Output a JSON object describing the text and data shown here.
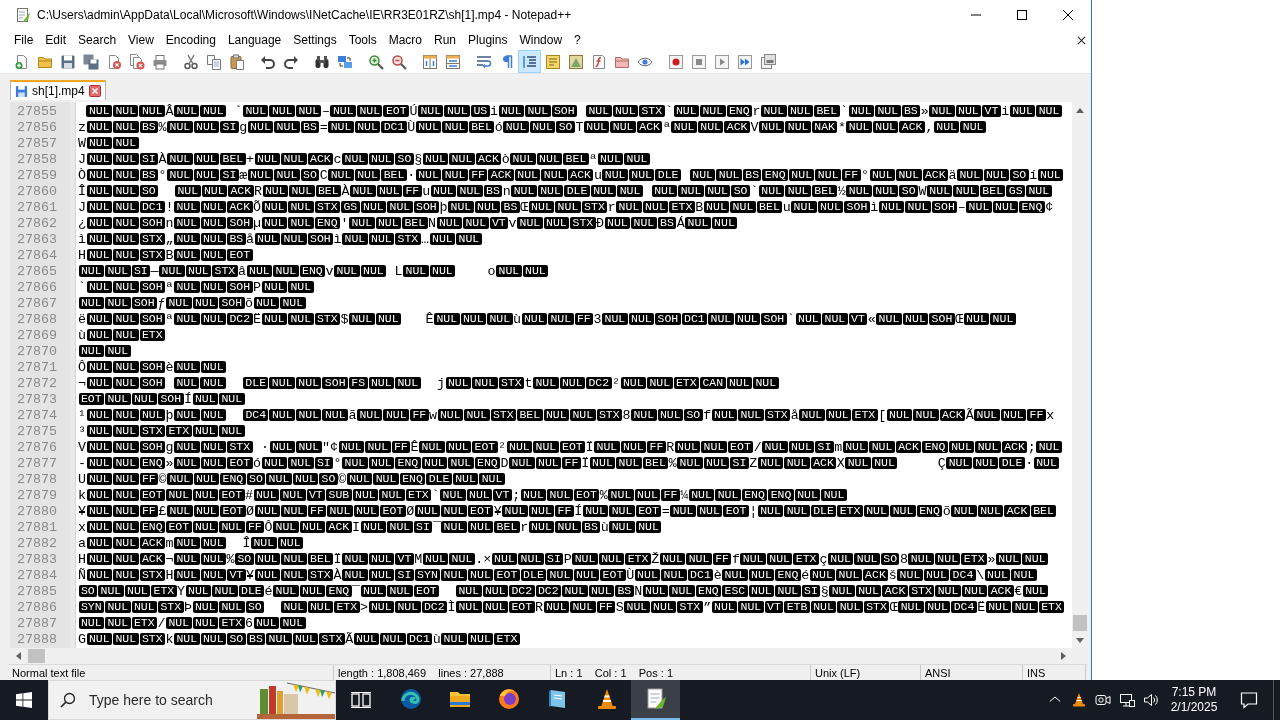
{
  "window": {
    "title": "C:\\Users\\admin\\AppData\\Local\\Microsoft\\Windows\\INetCache\\IE\\RR3E01RZ\\sh[1].mp4 - Notepad++"
  },
  "menu": [
    "File",
    "Edit",
    "Search",
    "View",
    "Encoding",
    "Language",
    "Settings",
    "Tools",
    "Macro",
    "Run",
    "Plugins",
    "Window",
    "?"
  ],
  "toolbar": [
    {
      "on": false
    },
    {
      "on": false
    },
    {
      "on": false
    },
    {
      "on": false
    },
    {
      "on": false
    },
    {
      "on": false
    },
    {
      "on": false
    },
    {
      "on": false
    },
    {
      "on": false
    },
    {
      "on": false
    },
    {
      "on": false
    },
    {
      "on": false
    },
    {
      "on": false
    },
    {
      "on": false
    },
    {
      "on": false
    },
    {
      "on": false
    },
    {
      "on": false
    },
    {
      "on": false
    },
    {
      "on": false
    },
    {
      "on": false
    },
    {
      "on": true
    },
    {
      "on": false
    },
    {
      "on": false
    },
    {
      "on": false
    },
    {
      "on": false
    },
    {
      "on": false
    },
    {
      "on": false
    },
    {
      "on": false
    },
    {
      "on": false
    },
    {
      "on": false
    },
    {
      "on": false
    }
  ],
  "tabs": [
    {
      "label": "sh[1].mp4",
      "selected": true
    }
  ],
  "editor": {
    "lines": [
      {
        "number": "27855",
        "indent": true,
        "groups": [
          {
            "codes": [
              "NUL",
              "NUL",
              "NUL"
            ],
            "after": "Â"
          },
          {
            "codes": [
              "NUL",
              "NUL"
            ],
            "after": " `"
          },
          {
            "codes": [
              "NUL",
              "NUL",
              "NUL"
            ],
            "after": "–"
          },
          {
            "codes": [
              "NUL",
              "NUL",
              "EOT"
            ],
            "after": "Ú"
          },
          {
            "codes": [
              "NUL",
              "NUL",
              "US"
            ],
            "after": "i"
          },
          {
            "codes": [
              "NUL",
              "NUL",
              "SOH"
            ],
            "gap": true
          },
          {
            "codes": [
              "NUL",
              "NUL",
              "STX"
            ],
            "after": "`"
          },
          {
            "codes": [
              "NUL",
              "NUL",
              "ENQ"
            ],
            "after": "r"
          },
          {
            "codes": [
              "NUL",
              "NUL",
              "BEL"
            ],
            "after": "`"
          },
          {
            "codes": [
              "NUL",
              "NUL",
              "BS"
            ],
            "after": "»"
          },
          {
            "codes": [
              "NUL",
              "NUL",
              "VT"
            ],
            "after": "i"
          },
          {
            "codes": [
              "NUL",
              "NUL"
            ]
          }
        ]
      },
      {
        "number": "27856",
        "lead": "z",
        "groups": [
          {
            "codes": [
              "NUL",
              "NUL",
              "BS"
            ],
            "after": "%"
          },
          {
            "codes": [
              "NUL",
              "NUL",
              "SI"
            ],
            "after": "g"
          },
          {
            "codes": [
              "NUL",
              "NUL",
              "BS"
            ],
            "after": "="
          },
          {
            "codes": [
              "NUL",
              "NUL",
              "DC1"
            ],
            "after": "Ù"
          },
          {
            "codes": [
              "NUL",
              "NUL",
              "BEL"
            ],
            "after": "ó"
          },
          {
            "codes": [
              "NUL",
              "NUL",
              "SO"
            ],
            "after": "T"
          },
          {
            "codes": [
              "NUL",
              "NUL",
              "ACK"
            ],
            "after": "ª"
          },
          {
            "codes": [
              "NUL",
              "NUL",
              "ACK"
            ],
            "after": "V"
          },
          {
            "codes": [
              "NUL",
              "NUL",
              "NAK"
            ],
            "after": "*"
          },
          {
            "codes": [
              "NUL",
              "NUL",
              "ACK"
            ],
            "after": ","
          },
          {
            "codes": [
              "NUL",
              "NUL"
            ]
          }
        ]
      },
      {
        "number": "27857",
        "lead": "W",
        "groups": [
          {
            "codes": [
              "NUL",
              "NUL"
            ]
          }
        ]
      },
      {
        "number": "27858",
        "lead": "J",
        "groups": [
          {
            "codes": [
              "NUL",
              "NUL",
              "SI"
            ],
            "after": "À"
          },
          {
            "codes": [
              "NUL",
              "NUL",
              "BEL"
            ],
            "after": "+"
          },
          {
            "codes": [
              "NUL",
              "NUL",
              "ACK"
            ],
            "after": "c"
          },
          {
            "codes": [
              "NUL",
              "NUL",
              "SO"
            ],
            "after": "§"
          },
          {
            "codes": [
              "NUL",
              "NUL",
              "ACK"
            ],
            "after": "ò"
          },
          {
            "codes": [
              "NUL",
              "NUL",
              "BEL"
            ],
            "after": "ª"
          },
          {
            "codes": [
              "NUL",
              "NUL"
            ]
          }
        ]
      },
      {
        "number": "27859",
        "lead": "Ò",
        "groups": [
          {
            "codes": [
              "NUL",
              "NUL",
              "BS"
            ],
            "after": "°"
          },
          {
            "codes": [
              "NUL",
              "NUL",
              "SI"
            ],
            "after": "æ"
          },
          {
            "codes": [
              "NUL",
              "NUL",
              "SO"
            ],
            "after": "C"
          },
          {
            "codes": [
              "NUL",
              "NUL",
              "BEL"
            ],
            "after": "·"
          },
          {
            "codes": [
              "NUL",
              "NUL",
              "FF",
              "ACK",
              "NUL",
              "NUL",
              "ACK"
            ],
            "after": "u"
          },
          {
            "codes": [
              "NUL",
              "NUL",
              "DLE"
            ],
            "gap": true
          },
          {
            "codes": [
              "NUL",
              "NUL",
              "BS",
              "ENQ",
              "NUL",
              "NUL",
              "FF"
            ],
            "after": "°"
          },
          {
            "codes": [
              "NUL",
              "NUL",
              "ACK"
            ],
            "after": "ä"
          },
          {
            "codes": [
              "NUL",
              "NUL",
              "SO"
            ],
            "after": "í"
          },
          {
            "codes": [
              "NUL"
            ]
          }
        ]
      },
      {
        "number": "27860",
        "lead": "Î",
        "groups": [
          {
            "codes": [
              "NUL",
              "NUL",
              "SO"
            ],
            "wide_gap": true
          },
          {
            "codes": [
              "NUL",
              "NUL",
              "ACK"
            ],
            "after": "R"
          },
          {
            "codes": [
              "NUL",
              "NUL",
              "BEL"
            ],
            "after": "À"
          },
          {
            "codes": [
              "NUL",
              "NUL",
              "FF"
            ],
            "after": "u"
          },
          {
            "codes": [
              "NUL",
              "NUL",
              "BS"
            ],
            "after": "n"
          },
          {
            "codes": [
              "NUL",
              "NUL",
              "DLE",
              "NUL",
              "NUL"
            ],
            "gap": true
          },
          {
            "codes": [
              "NUL",
              "NUL",
              "NUL",
              "SO"
            ],
            "after": "`"
          },
          {
            "codes": [
              "NUL",
              "NUL",
              "BEL"
            ],
            "after": "½"
          },
          {
            "codes": [
              "NUL",
              "NUL",
              "SO"
            ],
            "after": "W"
          },
          {
            "codes": [
              "NUL",
              "NUL",
              "BEL",
              "GS",
              "NUL"
            ]
          }
        ]
      },
      {
        "number": "27861",
        "lead": "J",
        "groups": [
          {
            "codes": [
              "NUL",
              "NUL",
              "DC1"
            ],
            "after": "!"
          },
          {
            "codes": [
              "NUL",
              "NUL",
              "ACK"
            ],
            "after": "Õ"
          },
          {
            "codes": [
              "NUL",
              "NUL",
              "STX",
              "GS",
              "NUL",
              "NUL",
              "SOH"
            ],
            "after": "þ"
          },
          {
            "codes": [
              "NUL",
              "NUL",
              "BS"
            ],
            "after": "Œ"
          },
          {
            "codes": [
              "NUL",
              "NUL",
              "STX"
            ],
            "after": "r"
          },
          {
            "codes": [
              "NUL",
              "NUL",
              "ETX"
            ],
            "after": "B"
          },
          {
            "codes": [
              "NUL",
              "NUL",
              "BEL"
            ],
            "after": "u"
          },
          {
            "codes": [
              "NUL",
              "NUL",
              "SOH"
            ],
            "after": "ì"
          },
          {
            "codes": [
              "NUL",
              "NUL",
              "SOH"
            ],
            "after": "–"
          },
          {
            "codes": [
              "NUL",
              "NUL",
              "ENQ"
            ],
            "after": "¢"
          }
        ]
      },
      {
        "number": "27862",
        "lead": "¿",
        "groups": [
          {
            "codes": [
              "NUL",
              "NUL",
              "SOH"
            ],
            "after": "n"
          },
          {
            "codes": [
              "NUL",
              "NUL",
              "SOH"
            ],
            "after": "µ"
          },
          {
            "codes": [
              "NUL",
              "NUL",
              "ENQ"
            ],
            "after": "'"
          },
          {
            "codes": [
              "NUL",
              "NUL",
              "BEL"
            ],
            "after": "N"
          },
          {
            "codes": [
              "NUL",
              "NUL",
              "VT"
            ],
            "after": "v"
          },
          {
            "codes": [
              "NUL",
              "NUL",
              "STX"
            ],
            "after": "Ð"
          },
          {
            "codes": [
              "NUL",
              "NUL",
              "BS"
            ],
            "after": "Á"
          },
          {
            "codes": [
              "NUL",
              "NUL"
            ]
          }
        ]
      },
      {
        "number": "27863",
        "lead": "ì",
        "groups": [
          {
            "codes": [
              "NUL",
              "NUL",
              "STX"
            ],
            "after": "„"
          },
          {
            "codes": [
              "NUL",
              "NUL",
              "BS"
            ],
            "after": "å"
          },
          {
            "codes": [
              "NUL",
              "NUL",
              "SOH"
            ],
            "after": "ì"
          },
          {
            "codes": [
              "NUL",
              "NUL",
              "STX"
            ],
            "after": "…"
          },
          {
            "codes": [
              "NUL",
              "NUL"
            ]
          }
        ]
      },
      {
        "number": "27864",
        "lead": "H",
        "groups": [
          {
            "codes": [
              "NUL",
              "NUL",
              "STX"
            ],
            "after": "B"
          },
          {
            "codes": [
              "NUL",
              "NUL",
              "EOT"
            ]
          }
        ]
      },
      {
        "number": "27865",
        "groups": [
          {
            "codes": [
              "NUL",
              "NUL",
              "SI"
            ],
            "after": "—"
          },
          {
            "codes": [
              "NUL",
              "NUL",
              "STX"
            ],
            "after": "â"
          },
          {
            "codes": [
              "NUL",
              "NUL",
              "ENQ"
            ],
            "after": "v"
          },
          {
            "codes": [
              "NUL",
              "NUL"
            ],
            "after": " L"
          },
          {
            "codes": [
              "NUL",
              "NUL"
            ],
            "after": "    o"
          },
          {
            "codes": [
              "NUL",
              "NUL"
            ]
          }
        ]
      },
      {
        "number": "27866",
        "lead": "`",
        "groups": [
          {
            "codes": [
              "NUL",
              "NUL",
              "SOH"
            ],
            "after": "ª"
          },
          {
            "codes": [
              "NUL",
              "NUL",
              "SOH"
            ],
            "after": "P"
          },
          {
            "codes": [
              "NUL",
              "NUL"
            ]
          }
        ]
      },
      {
        "number": "27867",
        "groups": [
          {
            "codes": [
              "NUL",
              "NUL",
              "SOH"
            ],
            "after": "ƒ"
          },
          {
            "codes": [
              "NUL",
              "NUL",
              "SOH"
            ],
            "after": "õ"
          },
          {
            "codes": [
              "NUL",
              "NUL"
            ]
          }
        ]
      },
      {
        "number": "27868",
        "lead": "ë",
        "groups": [
          {
            "codes": [
              "NUL",
              "NUL",
              "SOH"
            ],
            "after": "ª"
          },
          {
            "codes": [
              "NUL",
              "NUL",
              "DC2"
            ],
            "after": "Ë"
          },
          {
            "codes": [
              "NUL",
              "NUL",
              "STX"
            ],
            "after": "$"
          },
          {
            "codes": [
              "NUL",
              "NUL"
            ],
            "after": "   Ê"
          },
          {
            "codes": [
              "NUL",
              "NUL",
              "NUL"
            ],
            "after": "ù"
          },
          {
            "codes": [
              "NUL",
              "NUL",
              "FF"
            ],
            "after": "3"
          },
          {
            "codes": [
              "NUL",
              "NUL",
              "SOH",
              "DC1",
              "NUL",
              "NUL",
              "SOH"
            ],
            "after": "`"
          },
          {
            "codes": [
              "NUL",
              "NUL",
              "VT"
            ],
            "after": "«"
          },
          {
            "codes": [
              "NUL",
              "NUL",
              "SOH"
            ],
            "after": "Œ"
          },
          {
            "codes": [
              "NUL",
              "NUL"
            ]
          }
        ]
      },
      {
        "number": "27869",
        "lead": "ù",
        "groups": [
          {
            "codes": [
              "NUL",
              "NUL",
              "ETX"
            ]
          }
        ]
      },
      {
        "number": "27870",
        "groups": [
          {
            "codes": [
              "NUL",
              "NUL"
            ]
          }
        ]
      },
      {
        "number": "27871",
        "lead": "Ô",
        "groups": [
          {
            "codes": [
              "NUL",
              "NUL",
              "SOH"
            ],
            "after": "è"
          },
          {
            "codes": [
              "NUL",
              "NUL"
            ]
          }
        ]
      },
      {
        "number": "27872",
        "lead": "¬",
        "groups": [
          {
            "codes": [
              "NUL",
              "NUL",
              "SOH"
            ],
            "gap": true
          },
          {
            "codes": [
              "NUL",
              "NUL"
            ],
            "wide_gap": true
          },
          {
            "codes": [
              "DLE",
              "NUL",
              "NUL",
              "SOH",
              "FS",
              "NUL",
              "NUL"
            ],
            "after": "  j"
          },
          {
            "codes": [
              "NUL",
              "NUL",
              "STX"
            ],
            "after": "t"
          },
          {
            "codes": [
              "NUL",
              "NUL",
              "DC2"
            ],
            "after": "²"
          },
          {
            "codes": [
              "NUL",
              "NUL",
              "ETX",
              "CAN",
              "NUL",
              "NUL"
            ]
          }
        ]
      },
      {
        "number": "27873",
        "groups": [
          {
            "codes": [
              "EOT",
              "NUL",
              "NUL",
              "SOH"
            ],
            "after": "Í"
          },
          {
            "codes": [
              "NUL",
              "NUL"
            ]
          }
        ]
      },
      {
        "number": "27874",
        "lead": "¹",
        "groups": [
          {
            "codes": [
              "NUL",
              "NUL",
              "NUL"
            ],
            "after": "þ"
          },
          {
            "codes": [
              "NUL",
              "NUL"
            ],
            "wide_gap": true
          },
          {
            "codes": [
              "DC4",
              "NUL",
              "NUL",
              "NUL"
            ],
            "after": "ã"
          },
          {
            "codes": [
              "NUL",
              "NUL",
              "FF"
            ],
            "after": "w"
          },
          {
            "codes": [
              "NUL",
              "NUL",
              "STX",
              "BEL",
              "NUL",
              "NUL",
              "STX"
            ],
            "after": "8"
          },
          {
            "codes": [
              "NUL",
              "NUL",
              "SO"
            ],
            "after": "f"
          },
          {
            "codes": [
              "NUL",
              "NUL",
              "STX"
            ],
            "after": "å"
          },
          {
            "codes": [
              "NUL",
              "NUL",
              "ETX"
            ],
            "after": "["
          },
          {
            "codes": [
              "NUL",
              "NUL",
              "ACK"
            ],
            "after": "Ã"
          },
          {
            "codes": [
              "NUL",
              "NUL",
              "FF"
            ],
            "after": "x"
          }
        ]
      },
      {
        "number": "27875",
        "lead": "³",
        "groups": [
          {
            "codes": [
              "NUL",
              "NUL",
              "STX",
              "ETX",
              "NUL",
              "NUL"
            ]
          }
        ]
      },
      {
        "number": "27876",
        "lead": "V",
        "groups": [
          {
            "codes": [
              "NUL",
              "NUL",
              "SOH"
            ],
            "after": "g"
          },
          {
            "codes": [
              "NUL",
              "NUL",
              "STX"
            ],
            "after": " ·"
          },
          {
            "codes": [
              "NUL",
              "NUL"
            ],
            "after": "\"¢"
          },
          {
            "codes": [
              "NUL",
              "NUL",
              "FF"
            ],
            "after": "Ê"
          },
          {
            "codes": [
              "NUL",
              "NUL",
              "EOT"
            ],
            "after": "²"
          },
          {
            "codes": [
              "NUL",
              "NUL",
              "EOT"
            ],
            "after": "Ï"
          },
          {
            "codes": [
              "NUL",
              "NUL",
              "FF"
            ],
            "after": "R"
          },
          {
            "codes": [
              "NUL",
              "NUL",
              "EOT"
            ],
            "after": "/"
          },
          {
            "codes": [
              "NUL",
              "NUL",
              "SI"
            ],
            "after": "m"
          },
          {
            "codes": [
              "NUL",
              "NUL",
              "ACK",
              "ENQ",
              "NUL",
              "NUL",
              "ACK"
            ],
            "after": ";"
          },
          {
            "codes": [
              "NUL"
            ]
          }
        ]
      },
      {
        "number": "27877",
        "lead": "-",
        "groups": [
          {
            "codes": [
              "NUL",
              "NUL",
              "ENQ"
            ],
            "after": "»"
          },
          {
            "codes": [
              "NUL",
              "NUL",
              "EOT"
            ],
            "after": "ó"
          },
          {
            "codes": [
              "NUL",
              "NUL",
              "SI"
            ],
            "after": "°"
          },
          {
            "codes": [
              "NUL",
              "NUL",
              "ENQ",
              "NUL",
              "NUL",
              "ENQ"
            ],
            "after": "D"
          },
          {
            "codes": [
              "NUL",
              "NUL",
              "FF"
            ],
            "after": "Ï"
          },
          {
            "codes": [
              "NUL",
              "NUL",
              "BEL"
            ],
            "after": "%"
          },
          {
            "codes": [
              "NUL",
              "NUL",
              "SI"
            ],
            "after": "Z"
          },
          {
            "codes": [
              "NUL",
              "NUL",
              "ACK"
            ],
            "after": "X"
          },
          {
            "codes": [
              "NUL",
              "NUL"
            ],
            "after": "     Ç"
          },
          {
            "codes": [
              "NUL",
              "NUL",
              "DLE"
            ],
            "after": "·"
          },
          {
            "codes": [
              "NUL"
            ]
          }
        ]
      },
      {
        "number": "27878",
        "lead": "U",
        "groups": [
          {
            "codes": [
              "NUL",
              "NUL",
              "FF"
            ],
            "after": "©"
          },
          {
            "codes": [
              "NUL",
              "NUL",
              "ENQ",
              "SO",
              "NUL",
              "NUL",
              "SO"
            ],
            "after": "©"
          },
          {
            "codes": [
              "NUL",
              "NUL",
              "ENQ",
              "DLE",
              "NUL",
              "NUL"
            ]
          }
        ]
      },
      {
        "number": "27879",
        "lead": "k",
        "groups": [
          {
            "codes": [
              "NUL",
              "NUL",
              "EOT",
              "NUL",
              "NUL",
              "EOT"
            ],
            "after": "#"
          },
          {
            "codes": [
              "NUL",
              "NUL",
              "VT",
              "SUB",
              "NUL",
              "NUL",
              "ETX"
            ],
            "after": "`"
          },
          {
            "codes": [
              "NUL",
              "NUL",
              "VT"
            ],
            "after": ";"
          },
          {
            "codes": [
              "NUL",
              "NUL",
              "EOT"
            ],
            "after": "%"
          },
          {
            "codes": [
              "NUL",
              "NUL",
              "FF"
            ],
            "after": "¼"
          },
          {
            "codes": [
              "NUL",
              "NUL",
              "ENQ",
              "ENQ",
              "NUL",
              "NUL"
            ]
          }
        ]
      },
      {
        "number": "27880",
        "lead": "¥",
        "groups": [
          {
            "codes": [
              "NUL",
              "NUL",
              "FF"
            ],
            "after": "£"
          },
          {
            "codes": [
              "NUL",
              "NUL",
              "EOT"
            ],
            "after": "Ø"
          },
          {
            "codes": [
              "NUL",
              "NUL",
              "FF",
              "NUL",
              "NUL",
              "EOT"
            ],
            "after": "Ø"
          },
          {
            "codes": [
              "NUL",
              "NUL",
              "EOT"
            ],
            "after": "¥"
          },
          {
            "codes": [
              "NUL",
              "NUL",
              "FF"
            ],
            "after": "Í"
          },
          {
            "codes": [
              "NUL",
              "NUL",
              "EOT"
            ],
            "after": "="
          },
          {
            "codes": [
              "NUL",
              "NUL",
              "EOT"
            ],
            "after": "¦"
          },
          {
            "codes": [
              "NUL",
              "NUL",
              "DLE",
              "ETX",
              "NUL",
              "NUL",
              "ENQ"
            ],
            "after": "õ"
          },
          {
            "codes": [
              "NUL",
              "NUL",
              "ACK",
              "BEL"
            ]
          }
        ]
      },
      {
        "number": "27881",
        "lead": "x",
        "groups": [
          {
            "codes": [
              "NUL",
              "NUL",
              "ENQ",
              "EOT",
              "NUL",
              "NUL",
              "FF"
            ],
            "after": "Ô"
          },
          {
            "codes": [
              "NUL",
              "NUL",
              "ACK"
            ],
            "after": "I"
          },
          {
            "codes": [
              "NUL",
              "NUL",
              "SI"
            ],
            "after": "¯"
          },
          {
            "codes": [
              "NUL",
              "NUL",
              "BEL"
            ],
            "after": "r"
          },
          {
            "codes": [
              "NUL",
              "NUL",
              "BS"
            ],
            "after": "ù"
          },
          {
            "codes": [
              "NUL",
              "NUL"
            ]
          }
        ]
      },
      {
        "number": "27882",
        "lead": "a",
        "groups": [
          {
            "codes": [
              "NUL",
              "NUL",
              "ACK"
            ],
            "after": "m"
          },
          {
            "codes": [
              "NUL",
              "NUL"
            ],
            "after": "  Î"
          },
          {
            "codes": [
              "NUL",
              "NUL"
            ]
          }
        ]
      },
      {
        "number": "27883",
        "lead": "H",
        "groups": [
          {
            "codes": [
              "NUL",
              "NUL",
              "ACK"
            ],
            "after": "¬"
          },
          {
            "codes": [
              "NUL",
              "NUL"
            ],
            "after": "%"
          },
          {
            "codes": [
              "SO",
              "NUL",
              "NUL",
              "BEL"
            ],
            "after": "Ï"
          },
          {
            "codes": [
              "NUL",
              "NUL",
              "VT"
            ],
            "after": "M"
          },
          {
            "codes": [
              "NUL",
              "NUL"
            ],
            "after": ".×"
          },
          {
            "codes": [
              "NUL",
              "NUL",
              "SI"
            ],
            "after": "P"
          },
          {
            "codes": [
              "NUL",
              "NUL",
              "ETX"
            ],
            "after": "Ž"
          },
          {
            "codes": [
              "NUL",
              "NUL",
              "FF"
            ],
            "after": "f"
          },
          {
            "codes": [
              "NUL",
              "NUL",
              "ETX"
            ],
            "after": "ç"
          },
          {
            "codes": [
              "NUL",
              "NUL",
              "SO"
            ],
            "after": "8"
          },
          {
            "codes": [
              "NUL",
              "NUL",
              "ETX"
            ],
            "after": "»"
          },
          {
            "codes": [
              "NUL",
              "NUL"
            ]
          }
        ]
      },
      {
        "number": "27884",
        "lead": "Ñ",
        "groups": [
          {
            "codes": [
              "NUL",
              "NUL",
              "STX"
            ],
            "after": "H"
          },
          {
            "codes": [
              "NUL",
              "NUL",
              "VT"
            ],
            "after": "¥"
          },
          {
            "codes": [
              "NUL",
              "NUL",
              "STX"
            ],
            "after": "À"
          },
          {
            "codes": [
              "NUL",
              "NUL",
              "SI",
              "SYN",
              "NUL",
              "NUL",
              "EOT",
              "DLE",
              "NUL",
              "NUL",
              "EOT"
            ],
            "after": "Ù"
          },
          {
            "codes": [
              "NUL",
              "NUL",
              "DC1"
            ],
            "after": "è"
          },
          {
            "codes": [
              "NUL",
              "NUL",
              "ENQ"
            ],
            "after": "é"
          },
          {
            "codes": [
              "NUL",
              "NUL",
              "ACK"
            ],
            "after": "š"
          },
          {
            "codes": [
              "NUL",
              "NUL",
              "DC4"
            ],
            "after": "\\"
          },
          {
            "codes": [
              "NUL",
              "NUL"
            ]
          }
        ]
      },
      {
        "number": "27885",
        "groups": [
          {
            "codes": [
              "SO",
              "NUL",
              "NUL",
              "ETX"
            ],
            "after": "Y"
          },
          {
            "codes": [
              "NUL",
              "NUL",
              "DLE"
            ],
            "after": "é"
          },
          {
            "codes": [
              "NUL",
              "NUL",
              "ENQ"
            ],
            "after": "¯"
          },
          {
            "codes": [
              "NUL",
              "NUL",
              "EOT"
            ],
            "wide_gap": true
          },
          {
            "codes": [
              "NUL",
              "NUL",
              "DC2",
              "DC2",
              "NUL",
              "NUL",
              "BS"
            ],
            "after": "N"
          },
          {
            "codes": [
              "NUL",
              "NUL",
              "ENQ",
              "ESC",
              "NUL",
              "NUL",
              "SI"
            ],
            "after": "§"
          },
          {
            "codes": [
              "NUL",
              "NUL",
              "ACK",
              "STX",
              "NUL",
              "NUL",
              "ACK"
            ],
            "after": "€"
          },
          {
            "codes": [
              "NUL"
            ]
          }
        ]
      },
      {
        "number": "27886",
        "groups": [
          {
            "codes": [
              "SYN",
              "NUL",
              "NUL",
              "STX"
            ],
            "after": "Þ"
          },
          {
            "codes": [
              "NUL",
              "NUL",
              "SO"
            ],
            "wide_gap": true
          },
          {
            "codes": [
              "NUL",
              "NUL",
              "ETX"
            ],
            "after": ">"
          },
          {
            "codes": [
              "NUL",
              "NUL",
              "DC2"
            ],
            "after": "Ì"
          },
          {
            "codes": [
              "NUL",
              "NUL",
              "EOT"
            ],
            "after": "R"
          },
          {
            "codes": [
              "NUL",
              "NUL",
              "FF"
            ],
            "after": "S"
          },
          {
            "codes": [
              "NUL",
              "NUL",
              "STX"
            ],
            "after": "”"
          },
          {
            "codes": [
              "NUL",
              "NUL",
              "VT",
              "ETB",
              "NUL",
              "NUL",
              "STX"
            ],
            "after": "Œ"
          },
          {
            "codes": [
              "NUL",
              "NUL",
              "DC4"
            ],
            "after": "Ë"
          },
          {
            "codes": [
              "NUL",
              "NUL",
              "ETX"
            ]
          }
        ]
      },
      {
        "number": "27887",
        "groups": [
          {
            "codes": [
              "NUL",
              "NUL",
              "ETX"
            ],
            "after": "/"
          },
          {
            "codes": [
              "NUL",
              "NUL",
              "ETX"
            ],
            "after": "6"
          },
          {
            "codes": [
              "NUL",
              "NUL"
            ]
          }
        ]
      },
      {
        "number": "27888",
        "lead": "G",
        "groups": [
          {
            "codes": [
              "NUL",
              "NUL",
              "STX"
            ],
            "after": "k"
          },
          {
            "codes": [
              "NUL",
              "NUL",
              "SO",
              "BS",
              "NUL",
              "NUL",
              "STX"
            ],
            "after": "Ã"
          },
          {
            "codes": [
              "NUL",
              "NUL",
              "DC1"
            ],
            "after": "ù"
          },
          {
            "codes": [
              "NUL",
              "NUL",
              "ETX"
            ]
          }
        ]
      }
    ]
  },
  "status_bar": [
    "Normal text file",
    "length : 1,808,469    lines : 27,888",
    "Ln : 1    Col : 1    Pos : 1",
    "Unix (LF)",
    "ANSI",
    "INS"
  ],
  "taskbar": {
    "search": {
      "placeholder": "Type here to search"
    },
    "apps": [
      {
        "selected": false
      },
      {
        "selected": false
      },
      {
        "selected": false
      },
      {
        "selected": false
      },
      {
        "selected": false
      },
      {
        "selected": true
      }
    ],
    "clock": {
      "time": "7:15 PM",
      "date": "2/1/2025"
    }
  }
}
